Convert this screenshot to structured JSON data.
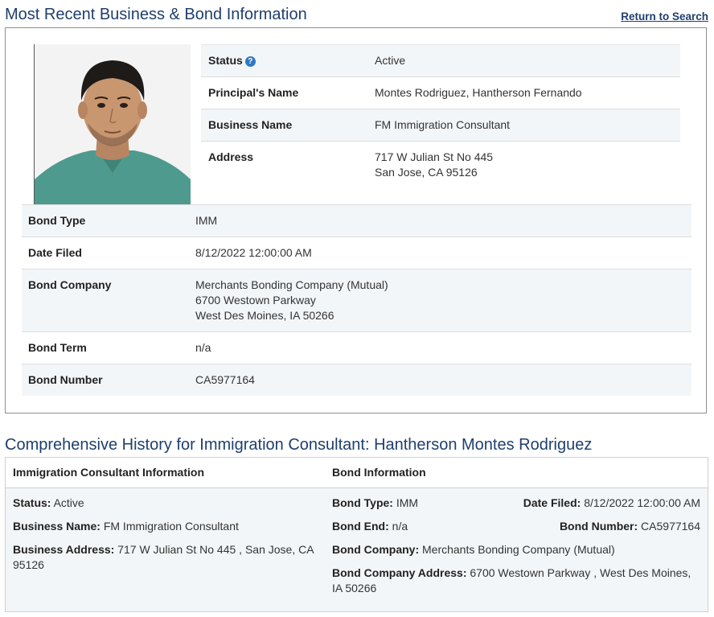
{
  "header": {
    "title": "Most Recent Business & Bond Information",
    "return_link": "Return to Search"
  },
  "info": {
    "status_label": "Status",
    "status_value": "Active",
    "principal_label": "Principal's Name",
    "principal_value": "Montes Rodriguez, Hantherson Fernando",
    "business_label": "Business Name",
    "business_value": "FM Immigration Consultant",
    "address_label": "Address",
    "address_line1": "717 W Julian St No 445",
    "address_line2": "San Jose, CA 95126"
  },
  "bond": {
    "type_label": "Bond Type",
    "type_value": "IMM",
    "date_label": "Date Filed",
    "date_value": "8/12/2022 12:00:00 AM",
    "company_label": "Bond Company",
    "company_line1": "Merchants Bonding Company (Mutual)",
    "company_line2": "6700 Westown Parkway",
    "company_line3": "West Des Moines, IA 50266",
    "term_label": "Bond Term",
    "term_value": "n/a",
    "number_label": "Bond Number",
    "number_value": "CA5977164"
  },
  "history": {
    "title": "Comprehensive History for Immigration Consultant: Hantherson Montes Rodriguez",
    "left_header": "Immigration Consultant Information",
    "right_header": "Bond Information",
    "status_label": "Status:",
    "status_value": " Active",
    "business_label": "Business Name:",
    "business_value": " FM Immigration Consultant",
    "address_label": "Business Address:",
    "address_value": " 717 W Julian St No 445 , San Jose, CA 95126",
    "bond_type_label": "Bond Type:",
    "bond_type_value": " IMM",
    "date_filed_label": "Date Filed:",
    "date_filed_value": " 8/12/2022 12:00:00 AM",
    "bond_end_label": "Bond End:",
    "bond_end_value": " n/a",
    "bond_number_label": "Bond Number:",
    "bond_number_value": " CA5977164",
    "bond_company_label": "Bond Company:",
    "bond_company_value": " Merchants Bonding Company (Mutual)",
    "bond_company_address_label": "Bond Company Address:",
    "bond_company_address_value": " 6700 Westown Parkway , West Des Moines, IA 50266"
  },
  "colors": {
    "heading": "#1f3f6d",
    "row_alt": "#f3f6f9",
    "help_icon": "#2f78c4"
  },
  "icons": {
    "status_help": "question-circle-icon"
  }
}
